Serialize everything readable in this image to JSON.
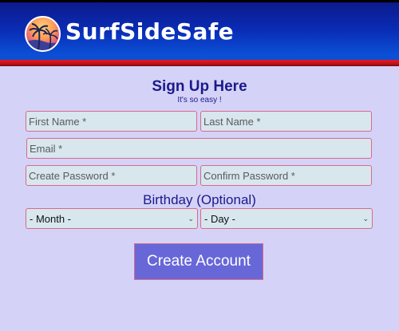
{
  "header": {
    "brand": "SurfSideSafe",
    "logo_icon": "palm-tree-sunset-logo-icon"
  },
  "form": {
    "title": "Sign Up Here",
    "subtitle": "It's so easy !",
    "first_name_placeholder": "First Name *",
    "last_name_placeholder": "Last Name *",
    "email_placeholder": "Email *",
    "create_password_placeholder": "Create Password *",
    "confirm_password_placeholder": "Confirm Password *",
    "birthday_label": "Birthday (Optional)",
    "month_selected": "- Month -",
    "day_selected": "- Day -",
    "submit_label": "Create Account"
  },
  "colors": {
    "background": "#d5d2f7",
    "header_blue": "#0a2cb5",
    "header_red_stripe": "#e41b23",
    "text_navy": "#1a1a8c",
    "field_bg": "#d8e6ee",
    "field_border": "#d86a8a",
    "button_bg": "#6767d8"
  }
}
